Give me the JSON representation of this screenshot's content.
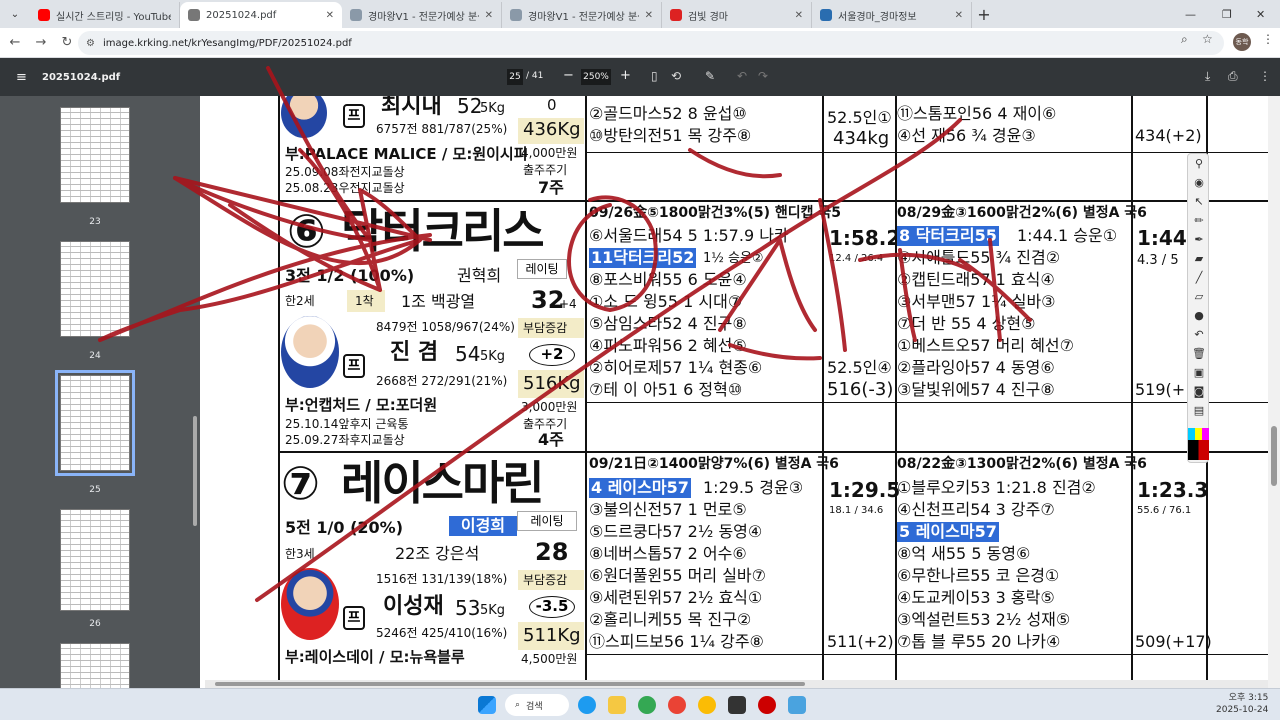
{
  "browser": {
    "tabs": [
      {
        "label": "실시간 스트리밍 - YouTube Stu",
        "color": "#ff0000",
        "active": false
      },
      {
        "label": "20251024.pdf",
        "color": "#4a4a4a",
        "active": true
      },
      {
        "label": "경마왕V1 - 전문가예상 분석은",
        "color": "#7b8b9a",
        "active": false
      },
      {
        "label": "경마왕V1 - 전문가예상 분석은",
        "color": "#7b8b9a",
        "active": false
      },
      {
        "label": "검빛 경마",
        "color": "#d22",
        "active": false
      },
      {
        "label": "서울경마_경마정보",
        "color": "#2a6db0",
        "active": false
      }
    ],
    "url": "image.krking.net/krYesangImg/PDF/20251024.pdf",
    "avatar_text": "동학"
  },
  "pdf_toolbar": {
    "file_name": "20251024.pdf",
    "page_current": "25",
    "page_total": "/ 41",
    "zoom": "250%"
  },
  "thumbnails": [
    {
      "label": "23",
      "selected": false
    },
    {
      "label": "24",
      "selected": false
    },
    {
      "label": "25",
      "selected": true
    },
    {
      "label": "26",
      "selected": false
    }
  ],
  "horse6": {
    "number": "⑥",
    "name": "닥터크리스",
    "record": "3전 1/2 (100%)",
    "trainer_label": "권혁희",
    "age": "한2세",
    "assoc": "1착",
    "group_trainer": "1조 백광열",
    "rating_label": "레이팅",
    "rating": "32",
    "rating_change": "+4",
    "trainer_stats": "8479전 1058/967(24%)",
    "jockey": "진 겸",
    "jockey_weight": "54",
    "weight_unit": "5Kg",
    "burden_label": "부담증감",
    "burden": "+2",
    "jockey_stats": "2668전 272/291(21%)",
    "body_weight": "516Kg",
    "prize": "3,000만원",
    "sire_dam": "부:언캡처드 / 모:포더원",
    "notes": [
      "25.10.14앞후지 근육통",
      "25.09.27좌후지교돌상"
    ],
    "out_label": "출주주기",
    "out_cycle": "4주",
    "race1": {
      "header_date": "09/26金⑤1800맑건3%(5) 핸디캡 국5",
      "highlight": "11닥터크리52",
      "entries": [
        "⑥서울드래54 5 1:57.9 나카",
        "⑧포스비워55 6 도윤④",
        "①소 드 윙55 1 시대⑦",
        "⑤삼임스타52 4 진구⑧",
        "④피노파워56 2 혜선⑤",
        "②히어로제57 1¼ 현종⑥",
        "⑦테 이 아51 6 정혁⑩"
      ],
      "time": "1:58.2",
      "split": "12.4 / 26.4",
      "winner_margin": "1½ 승운②",
      "body": "52.5인④",
      "body2": "516(-3)"
    },
    "race2": {
      "header_date": "08/29金③1600맑건2%(6) 별정A 국6",
      "highlight": "8 닥터크리55",
      "time_top": "1:44.1 승운①",
      "entries": [
        "④시애틀드55 ¾ 진겸②",
        "②캡틴드래57 1 효식④",
        "③서부맨57 1¼ 실바③",
        "⑦더 반 55 4 상현⑤",
        "①베스트오57 머리 혜선⑦",
        "②플라잉아57 4 동영⑥",
        "③달빛위에57 4 진구⑧"
      ],
      "time": "1:44.",
      "split": "4.3 / 5",
      "body": "519(+"
    }
  },
  "horse7": {
    "number": "⑦",
    "name": "레이스마린",
    "record": "5전 1/0 (20%)",
    "trainer": "이경희",
    "age": "한3세",
    "group_trainer": "22조 강은석",
    "rating_label": "레이팅",
    "rating": "28",
    "trainer_stats": "1516전 131/139(18%)",
    "jockey": "이성재",
    "jockey_weight": "53",
    "weight_unit": "5Kg",
    "burden_label": "부담증감",
    "burden": "-3.5",
    "jockey_stats": "5246전 425/410(16%)",
    "body_weight": "511Kg",
    "prize": "4,500만원",
    "sire_dam": "부:레이스데이 / 모:뉴욕블루",
    "race1": {
      "header_date": "09/21日②1400맑양7%(6) 별정A 국6",
      "highlight": "4 레이스마57",
      "time_top": "1:29.5 경윤③",
      "entries": [
        "③불의신전57 1 먼로⑤",
        "⑤드르쿵다57 2½ 동영④",
        "⑧네버스톱57 2 어수⑥",
        "⑥원더풀윈55 머리 실바⑦",
        "⑨세련된위57 2½ 효식①",
        "②홀리니케55 목 진구②",
        "⑪스피드보56 1¼ 강주⑧"
      ],
      "time": "1:29.5",
      "split": "18.1 / 34.6",
      "body": "511(+2)"
    },
    "race2": {
      "header_date": "08/22金③1300맑건2%(6) 별정A 국6",
      "highlight": "5 레이스마57",
      "entries": [
        "①블루오키53 1:21.8 진겸②",
        "④신천프리54 3 강주⑦",
        "⑧억 새55 5 동영⑥",
        "⑥무한나르55 코 은경①",
        "④도교케이53 3 홍락⑤",
        "③엑설런트53 2½ 성재⑤",
        "⑦톱 블 루55 20 나카④"
      ],
      "time": "1:23.3",
      "split": "55.6 / 76.1",
      "body": "509(+17)"
    }
  },
  "horse5_partial": {
    "name": "최시내",
    "weight": "52",
    "weight_unit": "5Kg",
    "jockey_stats": "6757전 881/787(25%)",
    "body_weight": "436Kg",
    "prize": "4,000만원",
    "sire_dam": "부:PALACE MALICE / 모:원이시피",
    "notes": [
      "25.09.08좌전지교돌상",
      "25.08.23우전지교돌상"
    ],
    "out_label": "출주주기",
    "out_cycle": "7주",
    "rating": "0",
    "race_entries": [
      "②골드마스52 8 윤섭⑩",
      "⑩방탄의전51 목 강주⑧"
    ],
    "race_entries2": [
      "⑪스톰포인56 4 재이⑥",
      "④선 재56 ¾ 경윤③"
    ],
    "time_partial": "52.5인①",
    "body": "434kg",
    "body2": "434(+2)"
  },
  "taskbar": {
    "search_label": "검색",
    "time": "오후 3:15",
    "date": "2025-10-24"
  },
  "colors": {
    "ink": "#a8141c",
    "highlight": "#2f6bd6",
    "tan": "#f3ecc8",
    "pdf_toolbar": "#323639",
    "thumb_panel": "#525659"
  }
}
